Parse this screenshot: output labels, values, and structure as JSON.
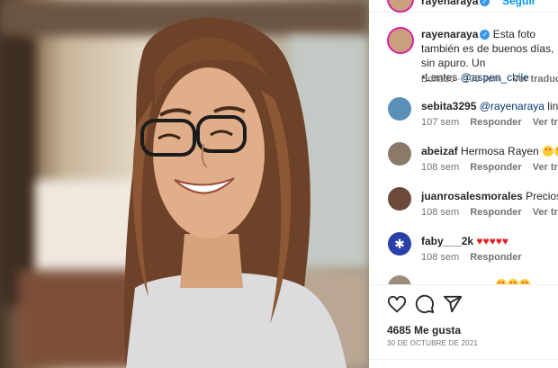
{
  "post": {
    "username": "rayenaraya",
    "follow_label": "Seguir",
    "caption_user": "rayenaraya",
    "caption_text": " Esta foto también es de buenos días, sin apuro. Un",
    "caption_lentes": "•Lentes ",
    "caption_mention": "@aspen_chile",
    "caption_edited": "Editado · 108 sem",
    "caption_translate": "Ver traducción"
  },
  "comments": [
    {
      "user": "sebita3295",
      "text": " lindas f",
      "mention": "@rayenaraya",
      "time": "107 sem",
      "reply": "Responder",
      "translate": "Ver traducción",
      "avatar_color": "#5a8fb8"
    },
    {
      "user": "abeizaf",
      "text": " Hermosa Rayen",
      "time": "108 sem",
      "reply": "Responder",
      "translate": "Ver traducción",
      "avatar_color": "#8a7a6a"
    },
    {
      "user": "juanrosalesmorales",
      "text": " Preciosa mi",
      "time": "108 sem",
      "reply": "Responder",
      "translate": "Ver traducción",
      "avatar_color": "#6b4a3a"
    },
    {
      "user": "faby___2k",
      "text": " ",
      "time": "108 sem",
      "reply": "Responder",
      "avatar_color": "#2a3fa8"
    }
  ],
  "actions": {
    "likes": "4685 Me gusta",
    "date": "30 DE OCTUBRE DE 2021"
  },
  "icons": [
    "heart-icon",
    "comment-icon",
    "share-icon",
    "verified-icon"
  ]
}
